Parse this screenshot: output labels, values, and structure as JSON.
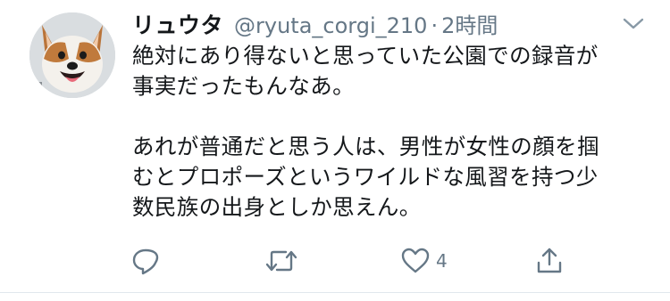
{
  "tweet": {
    "display_name": "リュウタ",
    "handle": "@ryuta_corgi_210",
    "separator": "·",
    "time": "2時間",
    "text": "絶対にあり得ないと思っていた公園での録音が\n事実だったもんなあ。\n\nあれが普通だと思う人は、男性が女性の顔を掴\nむとプロポーズというワイルドな風習を持つ少\n数民族の出身としか思えん。",
    "like_count": "4"
  },
  "icons": {
    "reply": "reply-icon",
    "retweet": "retweet-icon",
    "like": "heart-icon",
    "share": "share-icon",
    "menu": "chevron-down-icon"
  },
  "colors": {
    "text": "#14171a",
    "secondary": "#657786",
    "divider": "#e1e8ed"
  }
}
